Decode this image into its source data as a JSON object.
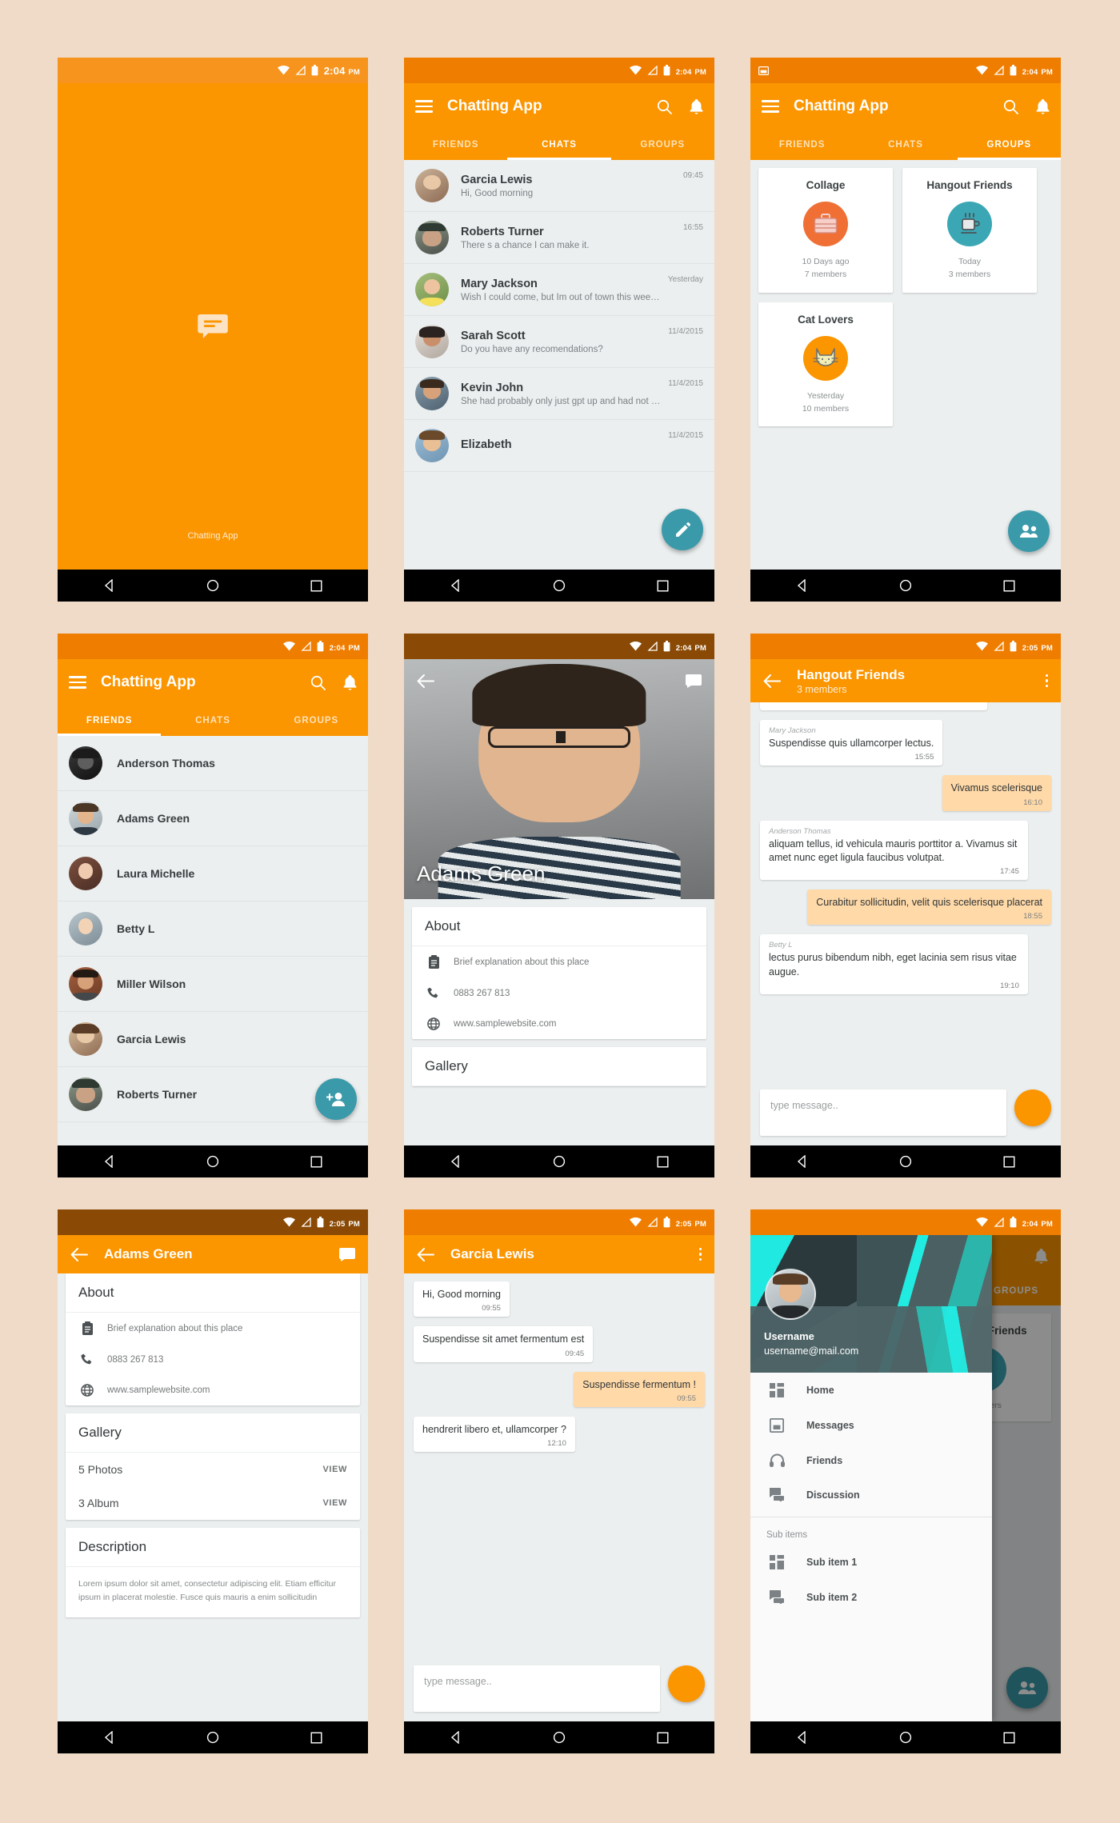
{
  "app": {
    "name": "Chatting App",
    "accent": "#fb9500",
    "accent_dark": "#ef7d00",
    "teal": "#3b9aaa",
    "bg": "#efdbc8"
  },
  "status": {
    "time_204": "2:04",
    "time_205": "2:05",
    "ampm": "PM"
  },
  "tabs": {
    "friends": "FRIENDS",
    "chats": "CHATS",
    "groups": "GROUPS"
  },
  "screen_splash": {
    "label": "Chatting App",
    "icon": "chat-bubble-icon"
  },
  "screen_chats": {
    "title": "Chatting App",
    "active_tab": "CHATS",
    "fab_icon": "pencil-icon",
    "items": [
      {
        "name": "Garcia Lewis",
        "message": "Hi, Good morning",
        "time": "09:45"
      },
      {
        "name": "Roberts Turner",
        "message": "There s a chance I can make it.",
        "time": "16:55"
      },
      {
        "name": "Mary Jackson",
        "message": "Wish I could come, but Im out of town this wee…",
        "time": "Yesterday"
      },
      {
        "name": "Sarah Scott",
        "message": "Do you have any recomendations?",
        "time": "11/4/2015"
      },
      {
        "name": "Kevin John",
        "message": "She had probably only just gpt up and had not e…",
        "time": "11/4/2015"
      },
      {
        "name": "Elizabeth",
        "message": "",
        "time": "11/4/2015"
      }
    ]
  },
  "screen_groups": {
    "title": "Chatting App",
    "active_tab": "GROUPS",
    "fab_icon": "group-add-icon",
    "cards": [
      {
        "title": "Collage",
        "icon": "briefcase-icon",
        "circle_color": "#ef6f34",
        "when": "10 Days ago",
        "members": "7 members"
      },
      {
        "title": "Hangout Friends",
        "icon": "coffee-cup-icon",
        "circle_color": "#3ba7b5",
        "when": "Today",
        "members": "3 members"
      },
      {
        "title": "Cat Lovers",
        "icon": "cat-face-icon",
        "circle_color": "#fb9500",
        "when": "Yesterday",
        "members": "10 members"
      }
    ]
  },
  "screen_friends": {
    "title": "Chatting App",
    "active_tab": "FRIENDS",
    "fab_icon": "person-add-icon",
    "items": [
      {
        "name": "Anderson Thomas"
      },
      {
        "name": "Adams Green"
      },
      {
        "name": "Laura Michelle"
      },
      {
        "name": "Betty L"
      },
      {
        "name": "Miller Wilson"
      },
      {
        "name": "Garcia Lewis"
      },
      {
        "name": "Roberts Turner"
      }
    ]
  },
  "screen_profile": {
    "hero_name": "Adams Green",
    "back_icon": "arrow-back-icon",
    "chat_icon": "chat-icon",
    "about": {
      "heading": "About",
      "rows": [
        {
          "icon": "clipboard-icon",
          "text": "Brief explanation about this place"
        },
        {
          "icon": "phone-icon",
          "text": "0883 267 813"
        },
        {
          "icon": "globe-icon",
          "text": "www.samplewebsite.com"
        }
      ]
    },
    "gallery": {
      "heading": "Gallery"
    }
  },
  "screen_group_chat": {
    "title": "Hangout Friends",
    "subtitle": "3 members",
    "back_icon": "arrow-back-icon",
    "overflow_icon": "more-vert-icon",
    "messages": [
      {
        "side": "in",
        "who": "",
        "text": "",
        "time": ""
      },
      {
        "side": "in",
        "who": "Mary Jackson",
        "text": "Suspendisse quis ullamcorper lectus.",
        "time": "15:55"
      },
      {
        "side": "out",
        "who": "",
        "text": "Vivamus scelerisque",
        "time": "16:10"
      },
      {
        "side": "in",
        "who": "Anderson Thomas",
        "text": "aliquam tellus, id vehicula mauris porttitor a. Vivamus sit amet nunc eget ligula faucibus volutpat.",
        "time": "17:45"
      },
      {
        "side": "out",
        "who": "",
        "text": "Curabitur sollicitudin, velit quis scelerisque placerat",
        "time": "18:55"
      },
      {
        "side": "in",
        "who": "Betty L",
        "text": "lectus purus bibendum nibh, eget lacinia sem risus vitae augue.",
        "time": "19:10"
      }
    ],
    "composer_placeholder": "type message.."
  },
  "screen_detail": {
    "title": "Adams Green",
    "back_icon": "arrow-back-icon",
    "chat_icon": "chat-icon",
    "about": {
      "heading": "About",
      "rows": [
        {
          "icon": "clipboard-icon",
          "text": "Brief explanation about this place"
        },
        {
          "icon": "phone-icon",
          "text": "0883 267 813"
        },
        {
          "icon": "globe-icon",
          "text": "www.samplewebsite.com"
        }
      ]
    },
    "gallery": {
      "heading": "Gallery",
      "rows": [
        {
          "label": "5 Photos",
          "action": "VIEW"
        },
        {
          "label": "3 Album",
          "action": "VIEW"
        }
      ]
    },
    "description": {
      "heading": "Description",
      "text": "Lorem ipsum dolor sit amet, consectetur adipiscing elit. Etiam efficitur ipsum in placerat molestie. Fusce quis mauris a enim sollicitudin"
    }
  },
  "screen_chat": {
    "title": "Garcia Lewis",
    "back_icon": "arrow-back-icon",
    "overflow_icon": "more-vert-icon",
    "messages": [
      {
        "side": "in",
        "text": "Hi, Good morning",
        "time": "09:55"
      },
      {
        "side": "in",
        "text": "Suspendisse sit amet fermentum est",
        "time": "09:45"
      },
      {
        "side": "out",
        "text": "Suspendisse fermentum !",
        "time": "09:55"
      },
      {
        "side": "in",
        "text": "hendrerit libero et, ullamcorper ?",
        "time": "12:10"
      }
    ],
    "composer_placeholder": "type message.."
  },
  "screen_drawer": {
    "username": "Username",
    "email": "username@mail.com",
    "items": [
      {
        "label": "Home",
        "icon": "dashboard-icon"
      },
      {
        "label": "Messages",
        "icon": "inbox-icon"
      },
      {
        "label": "Friends",
        "icon": "headphones-icon"
      },
      {
        "label": "Discussion",
        "icon": "forum-icon"
      }
    ],
    "sub_header": "Sub items",
    "sub_items": [
      {
        "label": "Sub item 1",
        "icon": "dashboard-icon"
      },
      {
        "label": "Sub item 2",
        "icon": "forum-icon"
      }
    ],
    "behind_tab": "GROUPS",
    "behind_card": "Hangout Friends",
    "behind_members": "members"
  },
  "navbar": {
    "back": "back-triangle-icon",
    "home": "home-circle-icon",
    "recents": "recents-square-icon"
  }
}
